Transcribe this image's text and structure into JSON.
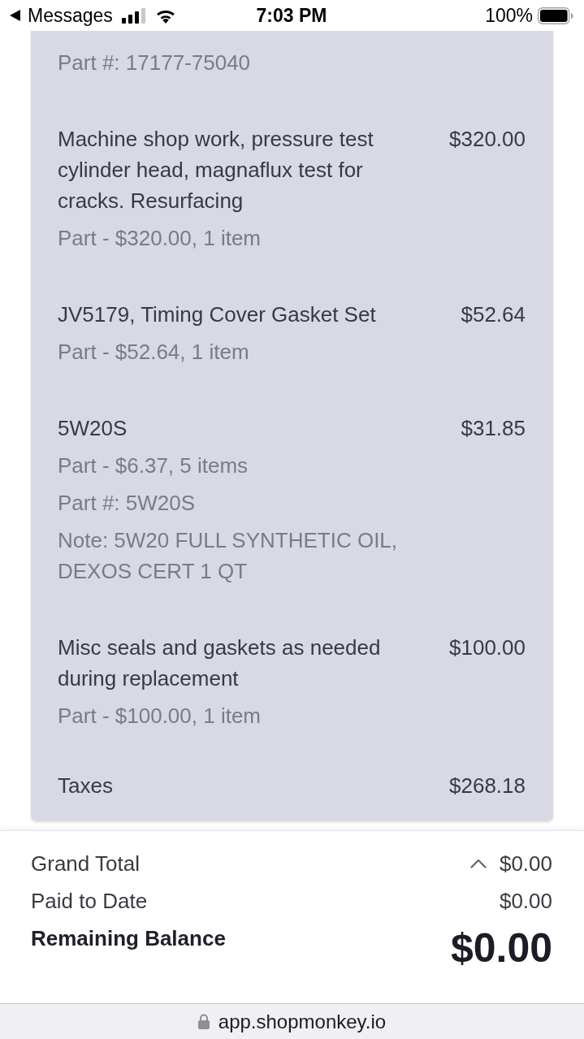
{
  "status_bar": {
    "back_label": "Messages",
    "time": "7:03 PM",
    "battery_percent": "100%"
  },
  "invoice": {
    "line_items": [
      {
        "details": [
          "Part #: 17177-75040"
        ]
      },
      {
        "title": "Machine shop work, pressure test cylinder head, magnaflux test for cracks. Resurfacing",
        "price": "$320.00",
        "details": [
          "Part - $320.00, 1 item"
        ]
      },
      {
        "title": "JV5179, Timing Cover Gasket Set",
        "price": "$52.64",
        "details": [
          "Part - $52.64, 1 item"
        ]
      },
      {
        "title": "5W20S",
        "price": "$31.85",
        "details": [
          "Part - $6.37, 5 items",
          "Part #: 5W20S",
          "Note: 5W20 FULL SYNTHETIC OIL, DEXOS CERT 1 QT"
        ]
      },
      {
        "title": "Misc seals and gaskets as needed during replacement",
        "price": "$100.00",
        "details": [
          "Part - $100.00, 1 item"
        ]
      }
    ],
    "taxes": {
      "label": "Taxes",
      "amount": "$268.18"
    }
  },
  "totals": {
    "grand_total": {
      "label": "Grand Total",
      "amount": "$0.00"
    },
    "paid_to_date": {
      "label": "Paid to Date",
      "amount": "$0.00"
    },
    "remaining_balance": {
      "label": "Remaining Balance",
      "amount": "$0.00"
    }
  },
  "browser": {
    "url": "app.shopmonkey.io"
  }
}
